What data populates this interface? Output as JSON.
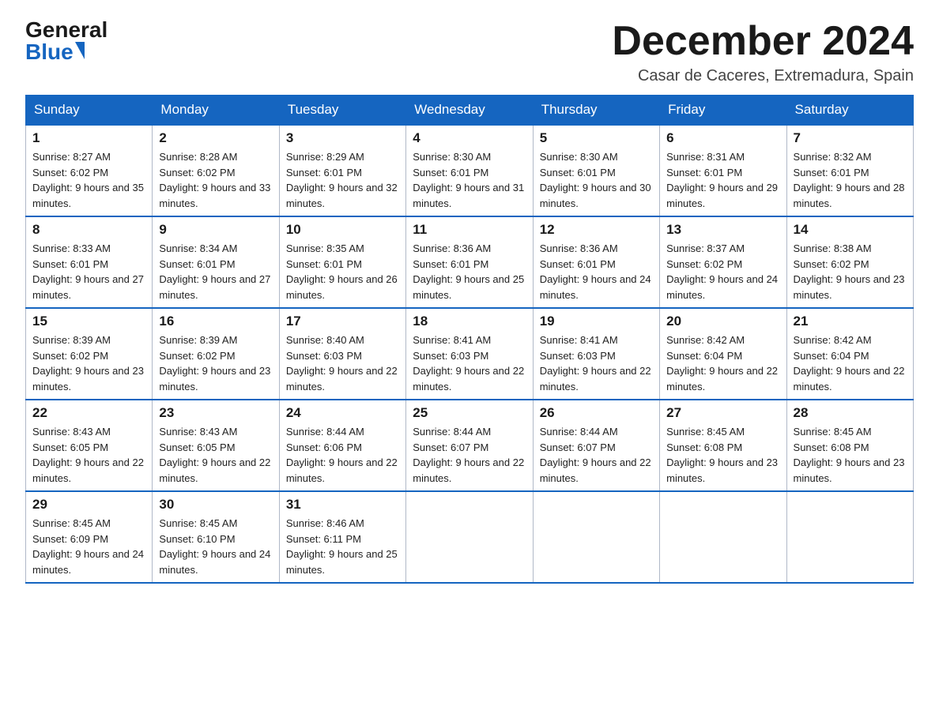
{
  "header": {
    "logo_general": "General",
    "logo_blue": "Blue",
    "month_title": "December 2024",
    "location": "Casar de Caceres, Extremadura, Spain"
  },
  "days_of_week": [
    "Sunday",
    "Monday",
    "Tuesday",
    "Wednesday",
    "Thursday",
    "Friday",
    "Saturday"
  ],
  "weeks": [
    [
      {
        "day": "1",
        "sunrise": "8:27 AM",
        "sunset": "6:02 PM",
        "daylight": "9 hours and 35 minutes."
      },
      {
        "day": "2",
        "sunrise": "8:28 AM",
        "sunset": "6:02 PM",
        "daylight": "9 hours and 33 minutes."
      },
      {
        "day": "3",
        "sunrise": "8:29 AM",
        "sunset": "6:01 PM",
        "daylight": "9 hours and 32 minutes."
      },
      {
        "day": "4",
        "sunrise": "8:30 AM",
        "sunset": "6:01 PM",
        "daylight": "9 hours and 31 minutes."
      },
      {
        "day": "5",
        "sunrise": "8:30 AM",
        "sunset": "6:01 PM",
        "daylight": "9 hours and 30 minutes."
      },
      {
        "day": "6",
        "sunrise": "8:31 AM",
        "sunset": "6:01 PM",
        "daylight": "9 hours and 29 minutes."
      },
      {
        "day": "7",
        "sunrise": "8:32 AM",
        "sunset": "6:01 PM",
        "daylight": "9 hours and 28 minutes."
      }
    ],
    [
      {
        "day": "8",
        "sunrise": "8:33 AM",
        "sunset": "6:01 PM",
        "daylight": "9 hours and 27 minutes."
      },
      {
        "day": "9",
        "sunrise": "8:34 AM",
        "sunset": "6:01 PM",
        "daylight": "9 hours and 27 minutes."
      },
      {
        "day": "10",
        "sunrise": "8:35 AM",
        "sunset": "6:01 PM",
        "daylight": "9 hours and 26 minutes."
      },
      {
        "day": "11",
        "sunrise": "8:36 AM",
        "sunset": "6:01 PM",
        "daylight": "9 hours and 25 minutes."
      },
      {
        "day": "12",
        "sunrise": "8:36 AM",
        "sunset": "6:01 PM",
        "daylight": "9 hours and 24 minutes."
      },
      {
        "day": "13",
        "sunrise": "8:37 AM",
        "sunset": "6:02 PM",
        "daylight": "9 hours and 24 minutes."
      },
      {
        "day": "14",
        "sunrise": "8:38 AM",
        "sunset": "6:02 PM",
        "daylight": "9 hours and 23 minutes."
      }
    ],
    [
      {
        "day": "15",
        "sunrise": "8:39 AM",
        "sunset": "6:02 PM",
        "daylight": "9 hours and 23 minutes."
      },
      {
        "day": "16",
        "sunrise": "8:39 AM",
        "sunset": "6:02 PM",
        "daylight": "9 hours and 23 minutes."
      },
      {
        "day": "17",
        "sunrise": "8:40 AM",
        "sunset": "6:03 PM",
        "daylight": "9 hours and 22 minutes."
      },
      {
        "day": "18",
        "sunrise": "8:41 AM",
        "sunset": "6:03 PM",
        "daylight": "9 hours and 22 minutes."
      },
      {
        "day": "19",
        "sunrise": "8:41 AM",
        "sunset": "6:03 PM",
        "daylight": "9 hours and 22 minutes."
      },
      {
        "day": "20",
        "sunrise": "8:42 AM",
        "sunset": "6:04 PM",
        "daylight": "9 hours and 22 minutes."
      },
      {
        "day": "21",
        "sunrise": "8:42 AM",
        "sunset": "6:04 PM",
        "daylight": "9 hours and 22 minutes."
      }
    ],
    [
      {
        "day": "22",
        "sunrise": "8:43 AM",
        "sunset": "6:05 PM",
        "daylight": "9 hours and 22 minutes."
      },
      {
        "day": "23",
        "sunrise": "8:43 AM",
        "sunset": "6:05 PM",
        "daylight": "9 hours and 22 minutes."
      },
      {
        "day": "24",
        "sunrise": "8:44 AM",
        "sunset": "6:06 PM",
        "daylight": "9 hours and 22 minutes."
      },
      {
        "day": "25",
        "sunrise": "8:44 AM",
        "sunset": "6:07 PM",
        "daylight": "9 hours and 22 minutes."
      },
      {
        "day": "26",
        "sunrise": "8:44 AM",
        "sunset": "6:07 PM",
        "daylight": "9 hours and 22 minutes."
      },
      {
        "day": "27",
        "sunrise": "8:45 AM",
        "sunset": "6:08 PM",
        "daylight": "9 hours and 23 minutes."
      },
      {
        "day": "28",
        "sunrise": "8:45 AM",
        "sunset": "6:08 PM",
        "daylight": "9 hours and 23 minutes."
      }
    ],
    [
      {
        "day": "29",
        "sunrise": "8:45 AM",
        "sunset": "6:09 PM",
        "daylight": "9 hours and 24 minutes."
      },
      {
        "day": "30",
        "sunrise": "8:45 AM",
        "sunset": "6:10 PM",
        "daylight": "9 hours and 24 minutes."
      },
      {
        "day": "31",
        "sunrise": "8:46 AM",
        "sunset": "6:11 PM",
        "daylight": "9 hours and 25 minutes."
      },
      null,
      null,
      null,
      null
    ]
  ]
}
